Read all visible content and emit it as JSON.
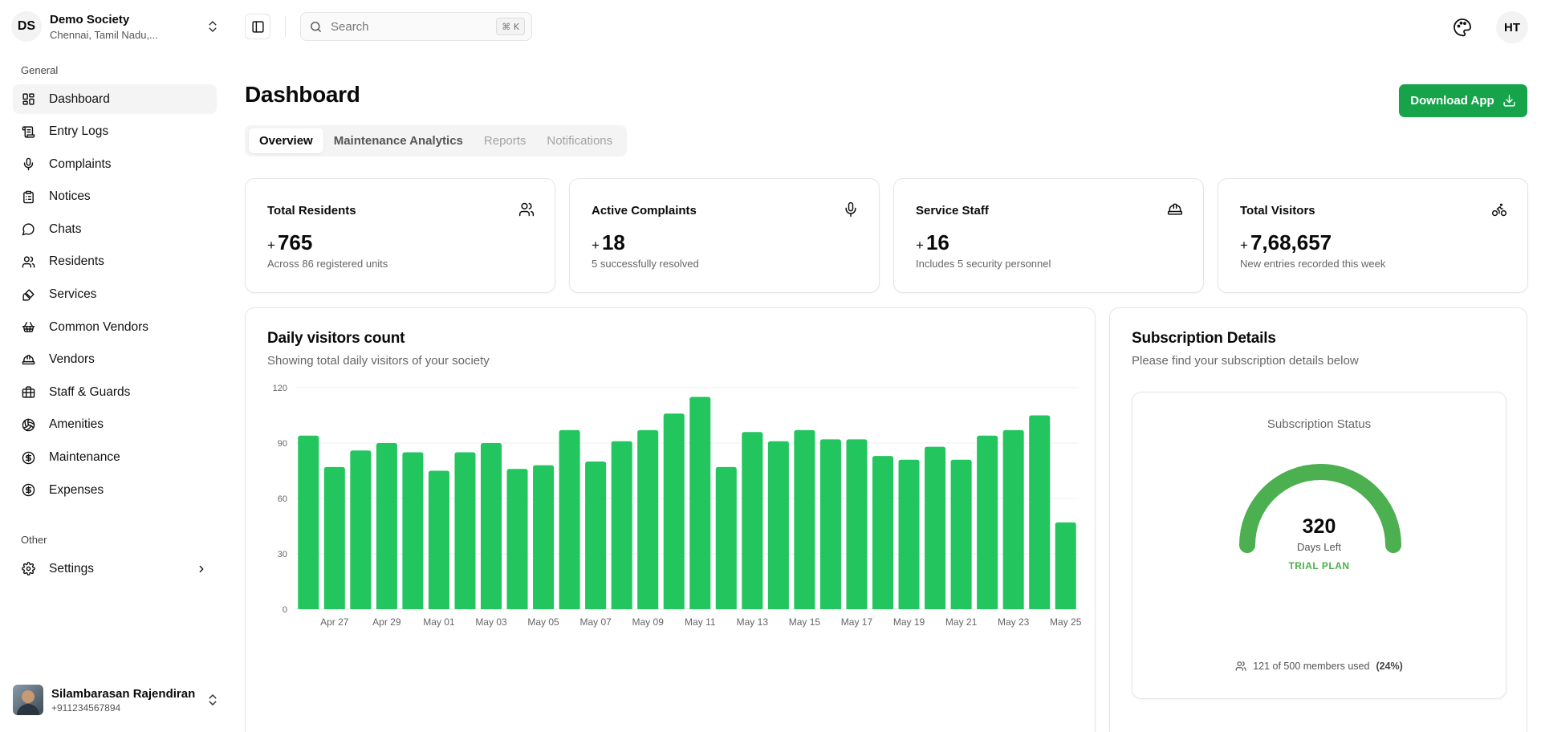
{
  "org": {
    "initials": "DS",
    "name": "Demo Society",
    "location": "Chennai, Tamil Nadu,..."
  },
  "nav": {
    "general_label": "General",
    "other_label": "Other",
    "items": [
      {
        "label": "Dashboard",
        "icon": "dashboard-icon"
      },
      {
        "label": "Entry Logs",
        "icon": "scroll-icon"
      },
      {
        "label": "Complaints",
        "icon": "mic-icon"
      },
      {
        "label": "Notices",
        "icon": "clipboard-icon"
      },
      {
        "label": "Chats",
        "icon": "chat-icon"
      },
      {
        "label": "Residents",
        "icon": "users-icon"
      },
      {
        "label": "Services",
        "icon": "brush-icon"
      },
      {
        "label": "Common Vendors",
        "icon": "basket-icon"
      },
      {
        "label": "Vendors",
        "icon": "hardhat-icon"
      },
      {
        "label": "Staff & Guards",
        "icon": "briefcase-icon"
      },
      {
        "label": "Amenities",
        "icon": "volleyball-icon"
      },
      {
        "label": "Maintenance",
        "icon": "dollar-circle-icon"
      },
      {
        "label": "Expenses",
        "icon": "dollar-circle-icon"
      }
    ],
    "settings_label": "Settings"
  },
  "user": {
    "name": "Silambarasan Rajendiran",
    "phone": "+911234567894"
  },
  "topbar": {
    "search_placeholder": "Search",
    "shortcut": "⌘ K",
    "avatar_initials": "HT"
  },
  "header": {
    "title": "Dashboard",
    "download_label": "Download App"
  },
  "tabs": [
    "Overview",
    "Maintenance Analytics",
    "Reports",
    "Notifications"
  ],
  "stats": [
    {
      "title": "Total Residents",
      "value": "765",
      "desc": "Across 86 registered units",
      "icon": "users-icon"
    },
    {
      "title": "Active Complaints",
      "value": "18",
      "desc": "5 successfully resolved",
      "icon": "mic-icon"
    },
    {
      "title": "Service Staff",
      "value": "16",
      "desc": "Includes 5 security personnel",
      "icon": "hardhat-icon"
    },
    {
      "title": "Total Visitors",
      "value": "7,68,657",
      "desc": "New entries recorded this week",
      "icon": "bike-icon"
    }
  ],
  "stat_plus": "+",
  "chart": {
    "title": "Daily visitors count",
    "subtitle": "Showing total daily visitors of your society"
  },
  "chart_data": {
    "type": "bar",
    "title": "Daily visitors count",
    "color": "#22c55e",
    "ylim": [
      0,
      120
    ],
    "yticks": [
      0,
      30,
      60,
      90,
      120
    ],
    "grid": true,
    "xtick_labels": [
      "Apr 27",
      "Apr 29",
      "May 01",
      "May 03",
      "May 05",
      "May 07",
      "May 09",
      "May 11",
      "May 13",
      "May 15",
      "May 17",
      "May 19",
      "May 21",
      "May 23",
      "May 25"
    ],
    "values": [
      94,
      77,
      86,
      90,
      85,
      75,
      85,
      90,
      76,
      78,
      97,
      80,
      91,
      97,
      106,
      115,
      77,
      96,
      91,
      97,
      92,
      92,
      83,
      81,
      88,
      81,
      94,
      97,
      105,
      47
    ]
  },
  "subscription": {
    "title": "Subscription Details",
    "subtitle": "Please find your subscription details below",
    "status_label": "Subscription Status",
    "days_left": "320",
    "days_label": "Days Left",
    "plan": "TRIAL PLAN",
    "members_text": "121 of 500 members used",
    "members_pct": "(24%)",
    "gauge_fill": 1.0,
    "gauge_color": "#4caf50"
  }
}
